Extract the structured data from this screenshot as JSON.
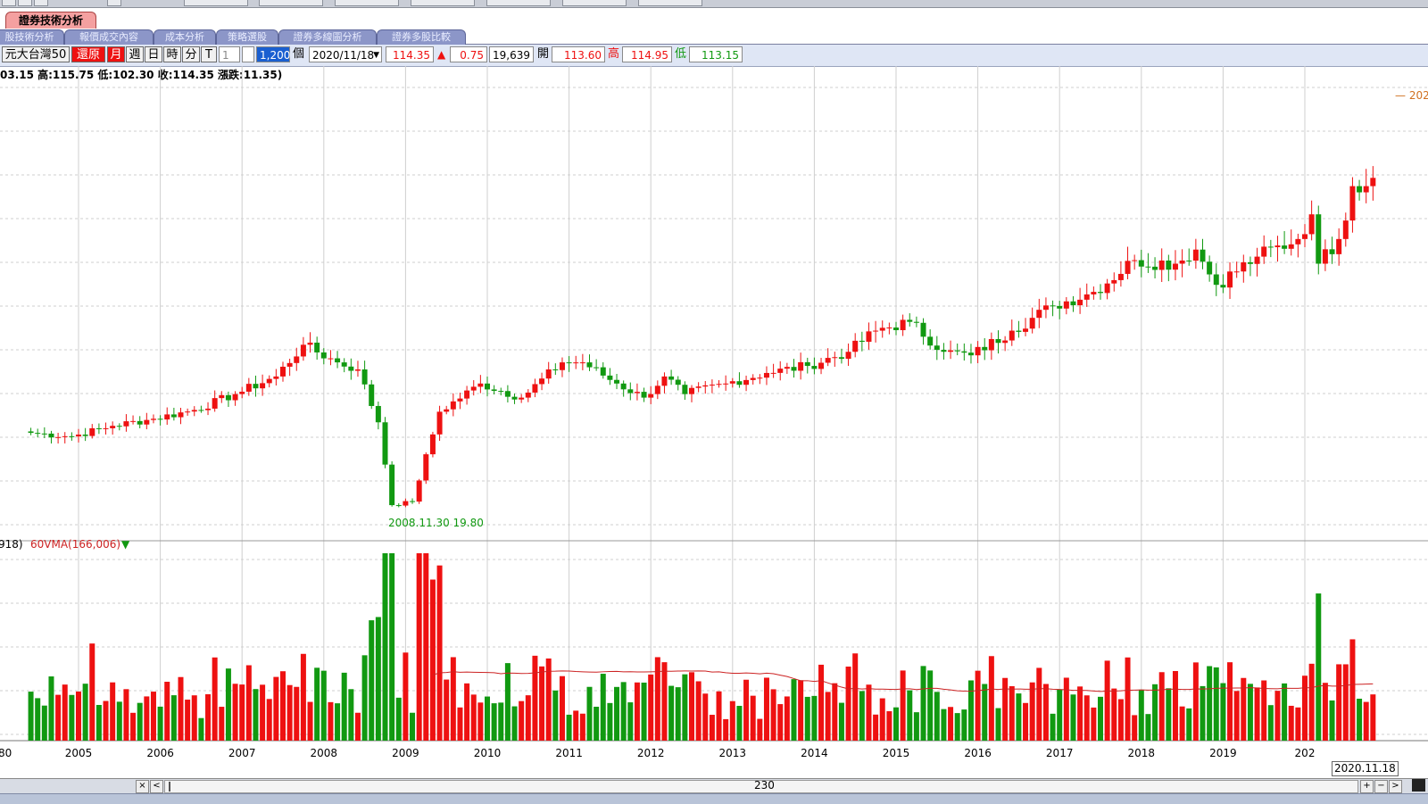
{
  "window": {
    "main_tab": "證券技術分析",
    "sub_tabs": [
      "股技術分析",
      "報價成交內容",
      "成本分析",
      "策略選股",
      "證券多線圖分析",
      "證券多股比較"
    ]
  },
  "toolbar": {
    "stock_name": "元大台灣50",
    "restore_label": "還原",
    "period_buttons": [
      "月",
      "週",
      "日",
      "時",
      "分",
      "T"
    ],
    "period_active": "月",
    "interval_value": "1",
    "count_value": "1,200",
    "count_unit": "個",
    "date_value": "2020/11/18",
    "last_price": "114.35",
    "change_arrow": "▲",
    "change": "0.75",
    "volume": "19,639",
    "open_label": "開",
    "open": "113.60",
    "high_label": "高",
    "high": "114.95",
    "low_label": "低",
    "low": "113.15"
  },
  "info_bar": "03.15 高:115.75 低:102.30 收:114.35 漲跌:11.35)",
  "volume_legend": {
    "left_fragment": "918)",
    "ma_label": "60VMA(166,006)",
    "ma_arrow": "▼"
  },
  "annotations": {
    "low_marker": "2008.11.30  19.80",
    "high_marker_fragment": "— 202"
  },
  "scrollbar": {
    "position_label": "230",
    "close_symbol": "×",
    "left_symbol": "<",
    "plus_symbol": "+",
    "minus_symbol": "−",
    "right_symbol": ">"
  },
  "cursor_date": "2020.11.18",
  "colors": {
    "up": "#ee1111",
    "down": "#119911",
    "ma_line": "#cc2222",
    "grid": "#cfcfcf"
  },
  "chart_data": {
    "type": "candlestick",
    "interval": "monthly",
    "x_ticks": [
      "2005",
      "2006",
      "2007",
      "2008",
      "2009",
      "2010",
      "2011",
      "2012",
      "2013",
      "2014",
      "2015",
      "2016",
      "2017",
      "2018",
      "2019",
      "202"
    ],
    "x_tick_left_fragment": "80",
    "price_min_labeled": 19.8,
    "anchors": [
      {
        "date": "2004-06",
        "close": 42.0
      },
      {
        "date": "2004-12",
        "close": 41.0
      },
      {
        "date": "2005-06",
        "close": 44.0
      },
      {
        "date": "2005-12",
        "close": 46.0
      },
      {
        "date": "2006-06",
        "close": 48.5
      },
      {
        "date": "2006-12",
        "close": 53.0
      },
      {
        "date": "2007-06",
        "close": 58.0
      },
      {
        "date": "2007-10",
        "close": 67.0
      },
      {
        "date": "2008-03",
        "close": 62.0
      },
      {
        "date": "2008-06",
        "close": 60.0
      },
      {
        "date": "2008-09",
        "close": 45.0
      },
      {
        "date": "2008-11",
        "close": 21.5
      },
      {
        "date": "2009-02",
        "close": 22.5
      },
      {
        "date": "2009-06",
        "close": 48.0
      },
      {
        "date": "2009-12",
        "close": 56.0
      },
      {
        "date": "2010-06",
        "close": 52.0
      },
      {
        "date": "2010-12",
        "close": 62.0
      },
      {
        "date": "2011-03",
        "close": 62.0
      },
      {
        "date": "2011-08",
        "close": 56.0
      },
      {
        "date": "2011-12",
        "close": 52.0
      },
      {
        "date": "2012-03",
        "close": 58.0
      },
      {
        "date": "2012-06",
        "close": 53.0
      },
      {
        "date": "2012-12",
        "close": 56.0
      },
      {
        "date": "2013-06",
        "close": 59.0
      },
      {
        "date": "2013-12",
        "close": 61.0
      },
      {
        "date": "2014-06",
        "close": 65.0
      },
      {
        "date": "2014-10",
        "close": 71.0
      },
      {
        "date": "2015-03",
        "close": 73.5
      },
      {
        "date": "2015-08",
        "close": 65.0
      },
      {
        "date": "2015-12",
        "close": 64.0
      },
      {
        "date": "2016-06",
        "close": 71.0
      },
      {
        "date": "2016-12",
        "close": 78.0
      },
      {
        "date": "2017-06",
        "close": 82.0
      },
      {
        "date": "2017-12",
        "close": 91.0
      },
      {
        "date": "2018-06",
        "close": 90.0
      },
      {
        "date": "2018-09",
        "close": 94.0
      },
      {
        "date": "2018-12",
        "close": 84.0
      },
      {
        "date": "2019-06",
        "close": 92.0
      },
      {
        "date": "2019-12",
        "close": 97.0
      },
      {
        "date": "2020-02",
        "close": 104.0
      },
      {
        "date": "2020-03",
        "close": 90.0
      },
      {
        "date": "2020-06",
        "close": 97.0
      },
      {
        "date": "2020-08",
        "close": 112.0
      },
      {
        "date": "2020-10",
        "close": 112.0
      },
      {
        "date": "2020-11",
        "close": 114.35
      }
    ],
    "volume_ma": {
      "name": "60VMA",
      "value": 166006
    }
  }
}
